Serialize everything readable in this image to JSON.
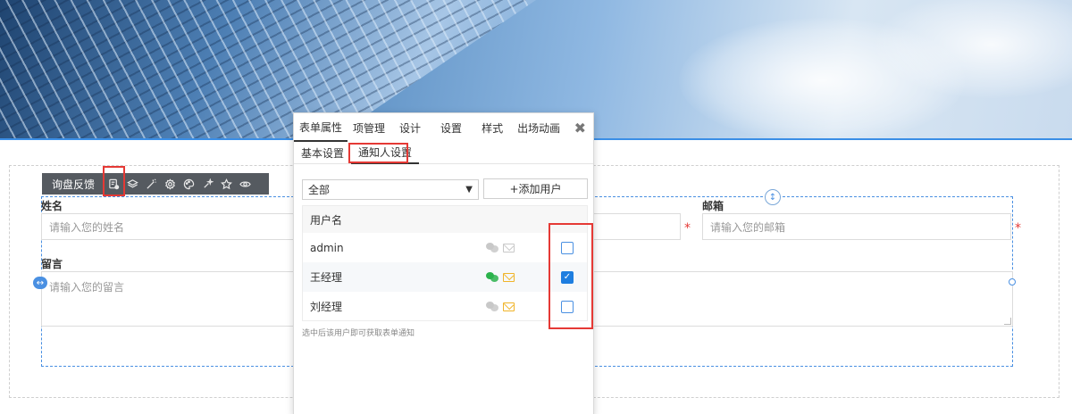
{
  "toolbar": {
    "title": "询盘反馈"
  },
  "form": {
    "name_label": "姓名",
    "name_placeholder": "请输入您的姓名",
    "email_label": "邮箱",
    "email_placeholder": "请输入您的邮箱",
    "message_label": "留言",
    "message_placeholder": "请输入您的留言",
    "required_mark": "*"
  },
  "panel": {
    "tabs": [
      "表单属性",
      "项管理",
      "设计",
      "设置",
      "样式",
      "出场动画"
    ],
    "active_tab": 0,
    "close": "✖",
    "sub_tabs": [
      "基本设置",
      "通知人设置"
    ],
    "active_sub_tab": 1,
    "filter_select": "全部",
    "add_user_button": "+添加用户",
    "table_header": "用户名",
    "users": [
      {
        "name": "admin",
        "wechat_active": false,
        "mail_active": false,
        "checked": false
      },
      {
        "name": "王经理",
        "wechat_active": true,
        "mail_active": true,
        "checked": true
      },
      {
        "name": "刘经理",
        "wechat_active": false,
        "mail_active": true,
        "checked": false
      }
    ],
    "hint": "选中后该用户即可获取表单通知"
  },
  "colors": {
    "accent": "#1e7ee0",
    "highlight": "#e53935",
    "wechat_active": "#2bb24c",
    "mail_active": "#f0b429",
    "inactive_icon": "#c8c8c8"
  }
}
